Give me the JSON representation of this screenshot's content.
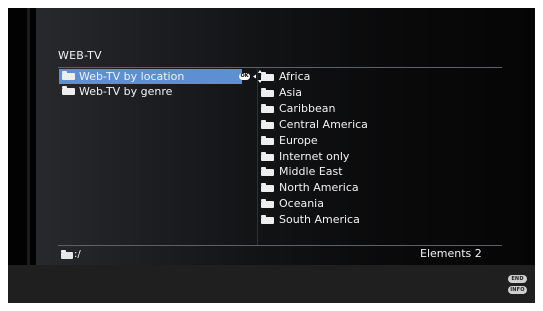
{
  "header": {
    "title": "WEB-TV"
  },
  "left_list": {
    "items": [
      {
        "label": "Web-TV by location",
        "selected": true
      },
      {
        "label": "Web-TV by genre",
        "selected": false
      }
    ],
    "ok_badge": "OK",
    "nav_icon": "dpad-arrows-icon"
  },
  "right_list": {
    "items": [
      "Africa",
      "Asia",
      "Caribbean",
      "Central America",
      "Europe",
      "Internet only",
      "Middle East",
      "North America",
      "Oceania",
      "South America"
    ]
  },
  "status": {
    "path": ":/",
    "elements": "Elements 2"
  },
  "remote_buttons": [
    {
      "label": "END",
      "icon": "end-button-icon"
    },
    {
      "label": "INFO",
      "icon": "info-button-icon"
    }
  ],
  "colors": {
    "selection": "#5d8fd3",
    "background": "#060606",
    "footer": "#1f1f1f"
  }
}
